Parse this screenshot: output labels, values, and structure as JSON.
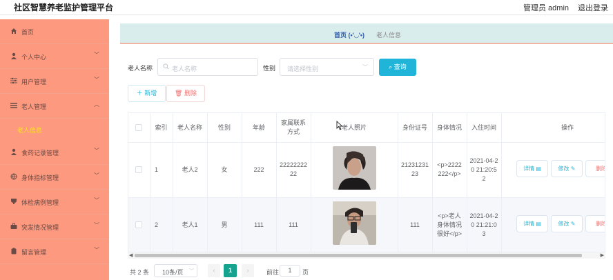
{
  "header": {
    "title": "社区智慧养老监护管理平台",
    "user": "管理员 admin",
    "logout": "退出登录"
  },
  "sidebar": {
    "items": [
      {
        "label": "首页",
        "icon": "home-icon",
        "chevron": false
      },
      {
        "label": "个人中心",
        "icon": "user-icon",
        "chevron": true
      },
      {
        "label": "用户管理",
        "icon": "sliders-icon",
        "chevron": true
      },
      {
        "label": "老人管理",
        "icon": "list-icon",
        "chevron": true,
        "expanded": true
      },
      {
        "label": "食药记录管理",
        "icon": "person-icon",
        "chevron": true
      },
      {
        "label": "身体指标管理",
        "icon": "globe-icon",
        "chevron": true
      },
      {
        "label": "体检病例管理",
        "icon": "cup-icon",
        "chevron": true
      },
      {
        "label": "突发情况管理",
        "icon": "briefcase-icon",
        "chevron": true
      },
      {
        "label": "留言管理",
        "icon": "clipboard-icon",
        "chevron": true
      }
    ],
    "active_sub": "老人信息"
  },
  "breadcrumb": {
    "home": "首页",
    "emoticon": "(•'◡'•)",
    "current": "老人信息"
  },
  "search": {
    "name_label": "老人名称",
    "name_placeholder": "老人名称",
    "gender_label": "性别",
    "gender_placeholder": "请选择性别",
    "query_button": "查询"
  },
  "actions": {
    "add": "新增",
    "delete": "删除"
  },
  "table": {
    "columns": [
      "索引",
      "老人名称",
      "性别",
      "年龄",
      "家属联系方式",
      "老人照片",
      "身份证号",
      "身体情况",
      "入住时间",
      "操作"
    ],
    "rows": [
      {
        "index": "1",
        "name": "老人2",
        "gender": "女",
        "age": "222",
        "contact": "2222222222",
        "id_card": "2123123123",
        "health": "<p>2222222</p>",
        "checkin": "2021-04-20 21:20:52"
      },
      {
        "index": "2",
        "name": "老人1",
        "gender": "男",
        "age": "111",
        "contact": "111",
        "id_card": "111",
        "health": "<p>老人身体情况很好</p>",
        "checkin": "2021-04-20 21:21:03"
      }
    ],
    "ops": {
      "detail": "详情",
      "edit": "修改",
      "delete": "删除"
    }
  },
  "pagination": {
    "total": "共 2 条",
    "page_size": "10条/页",
    "current_page": "1",
    "goto_label": "前往",
    "goto_value": "1",
    "page_suffix": "页"
  },
  "colors": {
    "sidebar_bg": "#fd997f",
    "accent": "#20b4d8",
    "page_active": "#15a38f",
    "danger": "#f56c6c",
    "submenu_active": "#ffdf2b"
  }
}
